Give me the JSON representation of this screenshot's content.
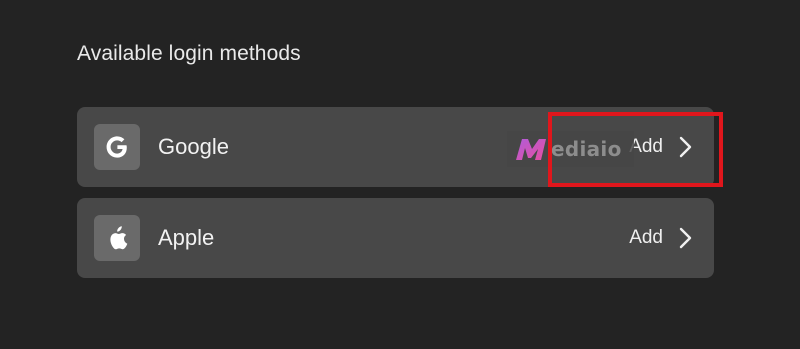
{
  "section": {
    "title": "Available login methods"
  },
  "methods": [
    {
      "name": "Google",
      "icon": "google-g-icon",
      "action_label": "Add"
    },
    {
      "name": "Apple",
      "icon": "apple-icon",
      "action_label": "Add"
    }
  ],
  "annotation": {
    "highlight_color": "#e0161c",
    "highlight_target": "google-add-action"
  },
  "watermark": {
    "text": "ediaio",
    "logo": "mediaio-m-icon"
  },
  "colors": {
    "background": "#232323",
    "row": "#484848",
    "icon_tile": "#6a6a6a",
    "text": "#f2f2f2"
  }
}
